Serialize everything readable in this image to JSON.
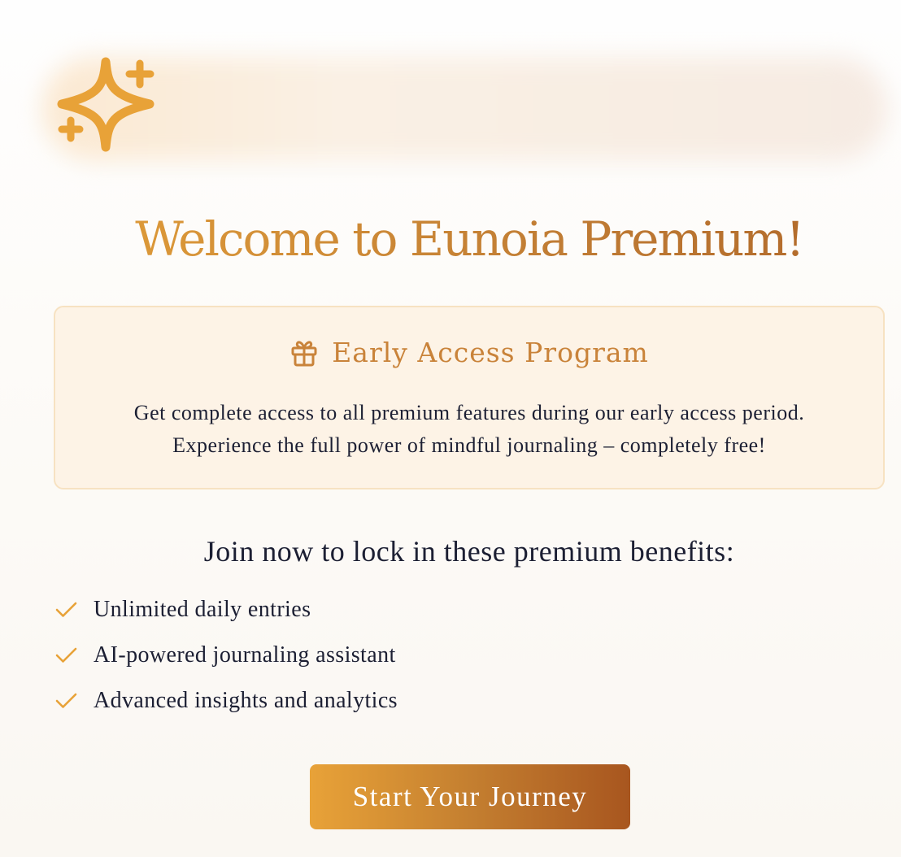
{
  "colors": {
    "accent": "#e8a238",
    "accent_dark": "#a8561f",
    "promo_bg": "#fdf3e6",
    "promo_border": "#f7e2c2",
    "text": "#1c1f33"
  },
  "hero": {
    "icon": "sparkles-icon"
  },
  "title": "Welcome to Eunoia Premium!",
  "promo": {
    "icon": "gift-icon",
    "heading": "Early Access Program",
    "line1": "Get complete access to all premium features during our early access period.",
    "line2": "Experience the full power of mindful journaling – completely free!"
  },
  "benefits": {
    "heading": "Join now to lock in these premium benefits:",
    "icon": "check-icon",
    "items": [
      "Unlimited daily entries",
      "AI-powered journaling assistant",
      "Advanced insights and analytics"
    ]
  },
  "cta": {
    "label": "Start Your Journey"
  }
}
